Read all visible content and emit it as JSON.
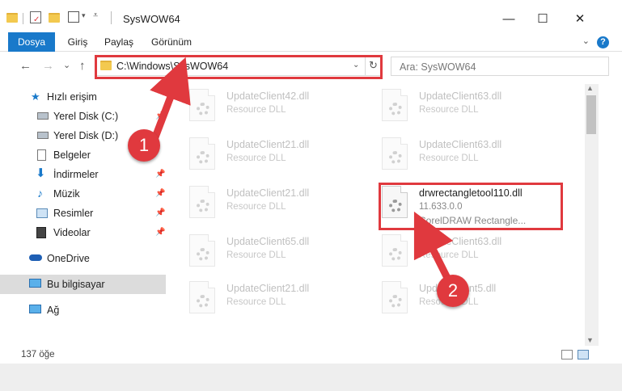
{
  "window": {
    "title": "SysWOW64",
    "minimize_glyph": "—",
    "maximize_glyph": "☐",
    "close_glyph": "✕"
  },
  "ribbon": {
    "tabs": [
      "Dosya",
      "Giriş",
      "Paylaş",
      "Görünüm"
    ],
    "help_glyph": "?"
  },
  "navigation": {
    "back_glyph": "←",
    "forward_glyph": "→",
    "recent_glyph": "⌄",
    "up_glyph": "↑",
    "address": "C:\\Windows\\SysWOW64",
    "search_placeholder": "Ara: SysWOW64"
  },
  "sidebar": {
    "items": [
      {
        "label": "Hızlı erişim",
        "icon": "star-icon"
      },
      {
        "label": "Yerel Disk (C:)",
        "icon": "drive-icon"
      },
      {
        "label": "Yerel Disk (D:)",
        "icon": "drive-icon"
      },
      {
        "label": "Belgeler",
        "icon": "documents-icon"
      },
      {
        "label": "İndirmeler",
        "icon": "download-icon"
      },
      {
        "label": "Müzik",
        "icon": "music-icon"
      },
      {
        "label": "Resimler",
        "icon": "pictures-icon"
      },
      {
        "label": "Videolar",
        "icon": "video-icon"
      },
      {
        "label": "OneDrive",
        "icon": "cloud-icon"
      },
      {
        "label": "Bu bilgisayar",
        "icon": "computer-icon"
      },
      {
        "label": "Ağ",
        "icon": "network-icon"
      }
    ]
  },
  "files": [
    {
      "name": "UpdateClient42.dll",
      "desc": "Resource DLL"
    },
    {
      "name": "UpdateClient63.dll",
      "desc": "Resource DLL"
    },
    {
      "name": "UpdateClient21.dll",
      "desc": "Resource DLL"
    },
    {
      "name": "UpdateClient63.dll",
      "desc": "Resource DLL"
    },
    {
      "name": "UpdateClient21.dll",
      "desc": "Resource DLL"
    },
    {
      "name": "drwrectangletool110.dll",
      "desc": "11.633.0.0",
      "desc2": "CorelDRAW Rectangle..."
    },
    {
      "name": "UpdateClient65.dll",
      "desc": "Resource DLL"
    },
    {
      "name": "UpdateClient63.dll",
      "desc": "Resource DLL"
    },
    {
      "name": "UpdateClient21.dll",
      "desc": "Resource DLL"
    },
    {
      "name": "UpdateClient5.dll",
      "desc": "Resource DLL"
    }
  ],
  "status": {
    "item_count": "137 öğe"
  },
  "annotations": {
    "step1": "1",
    "step2": "2"
  },
  "colors": {
    "accent": "#1979ca",
    "highlight": "#e0393e"
  }
}
